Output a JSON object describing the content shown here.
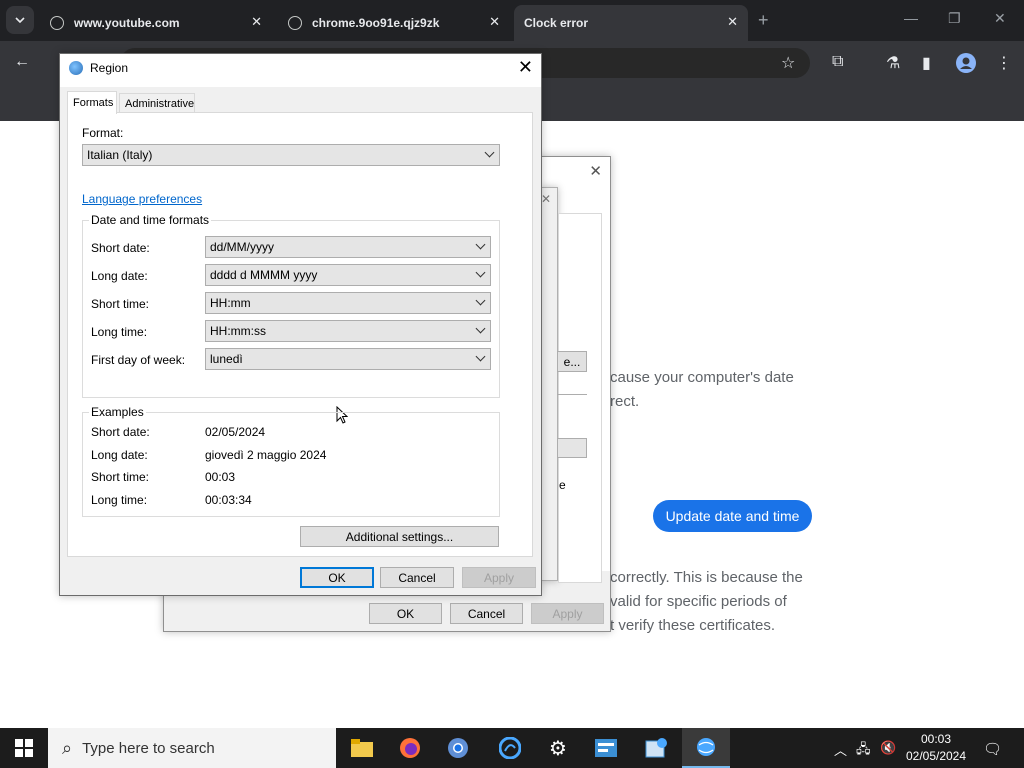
{
  "browser": {
    "tabs": [
      {
        "title": "www.youtube.com"
      },
      {
        "title": "chrome.9oo91e.qjz9zk"
      },
      {
        "title": "Clock error"
      }
    ],
    "new_tab": "+",
    "close_glyph": "✕"
  },
  "page": {
    "paragraph1_line1": "cause your computer's date",
    "paragraph1_line2": "rect.",
    "update_button": "Update date and time",
    "paragraph2_line1": "correctly. This is because the",
    "paragraph2_line2": "valid for specific periods of",
    "paragraph2_line3": "t verify these certificates."
  },
  "back_dialog": {
    "ok": "OK",
    "cancel": "Cancel",
    "apply": "Apply",
    "partial_button": "e...",
    "partial_text": "e"
  },
  "region_dialog": {
    "title": "Region",
    "tabs": [
      "Formats",
      "Administrative"
    ],
    "format_label": "Format:",
    "format_value": "Italian (Italy)",
    "language_link": "Language preferences",
    "dt_group_title": "Date and time formats",
    "dt_rows": [
      {
        "label": "Short date:",
        "value": "dd/MM/yyyy"
      },
      {
        "label": "Long date:",
        "value": "dddd d MMMM yyyy"
      },
      {
        "label": "Short time:",
        "value": "HH:mm"
      },
      {
        "label": "Long time:",
        "value": "HH:mm:ss"
      },
      {
        "label": "First day of week:",
        "value": "lunedì"
      }
    ],
    "examples_title": "Examples",
    "examples": [
      {
        "label": "Short date:",
        "value": "02/05/2024"
      },
      {
        "label": "Long date:",
        "value": "giovedì 2 maggio 2024"
      },
      {
        "label": "Short time:",
        "value": "00:03"
      },
      {
        "label": "Long time:",
        "value": "00:03:34"
      }
    ],
    "additional_settings": "Additional settings...",
    "ok": "OK",
    "cancel": "Cancel",
    "apply": "Apply"
  },
  "taskbar": {
    "search_placeholder": "Type here to search",
    "time": "00:03",
    "date": "02/05/2024"
  },
  "colors": {
    "accent": "#1a73e8",
    "chrome_dark": "#202124",
    "taskbar": "#1c1c1c"
  }
}
